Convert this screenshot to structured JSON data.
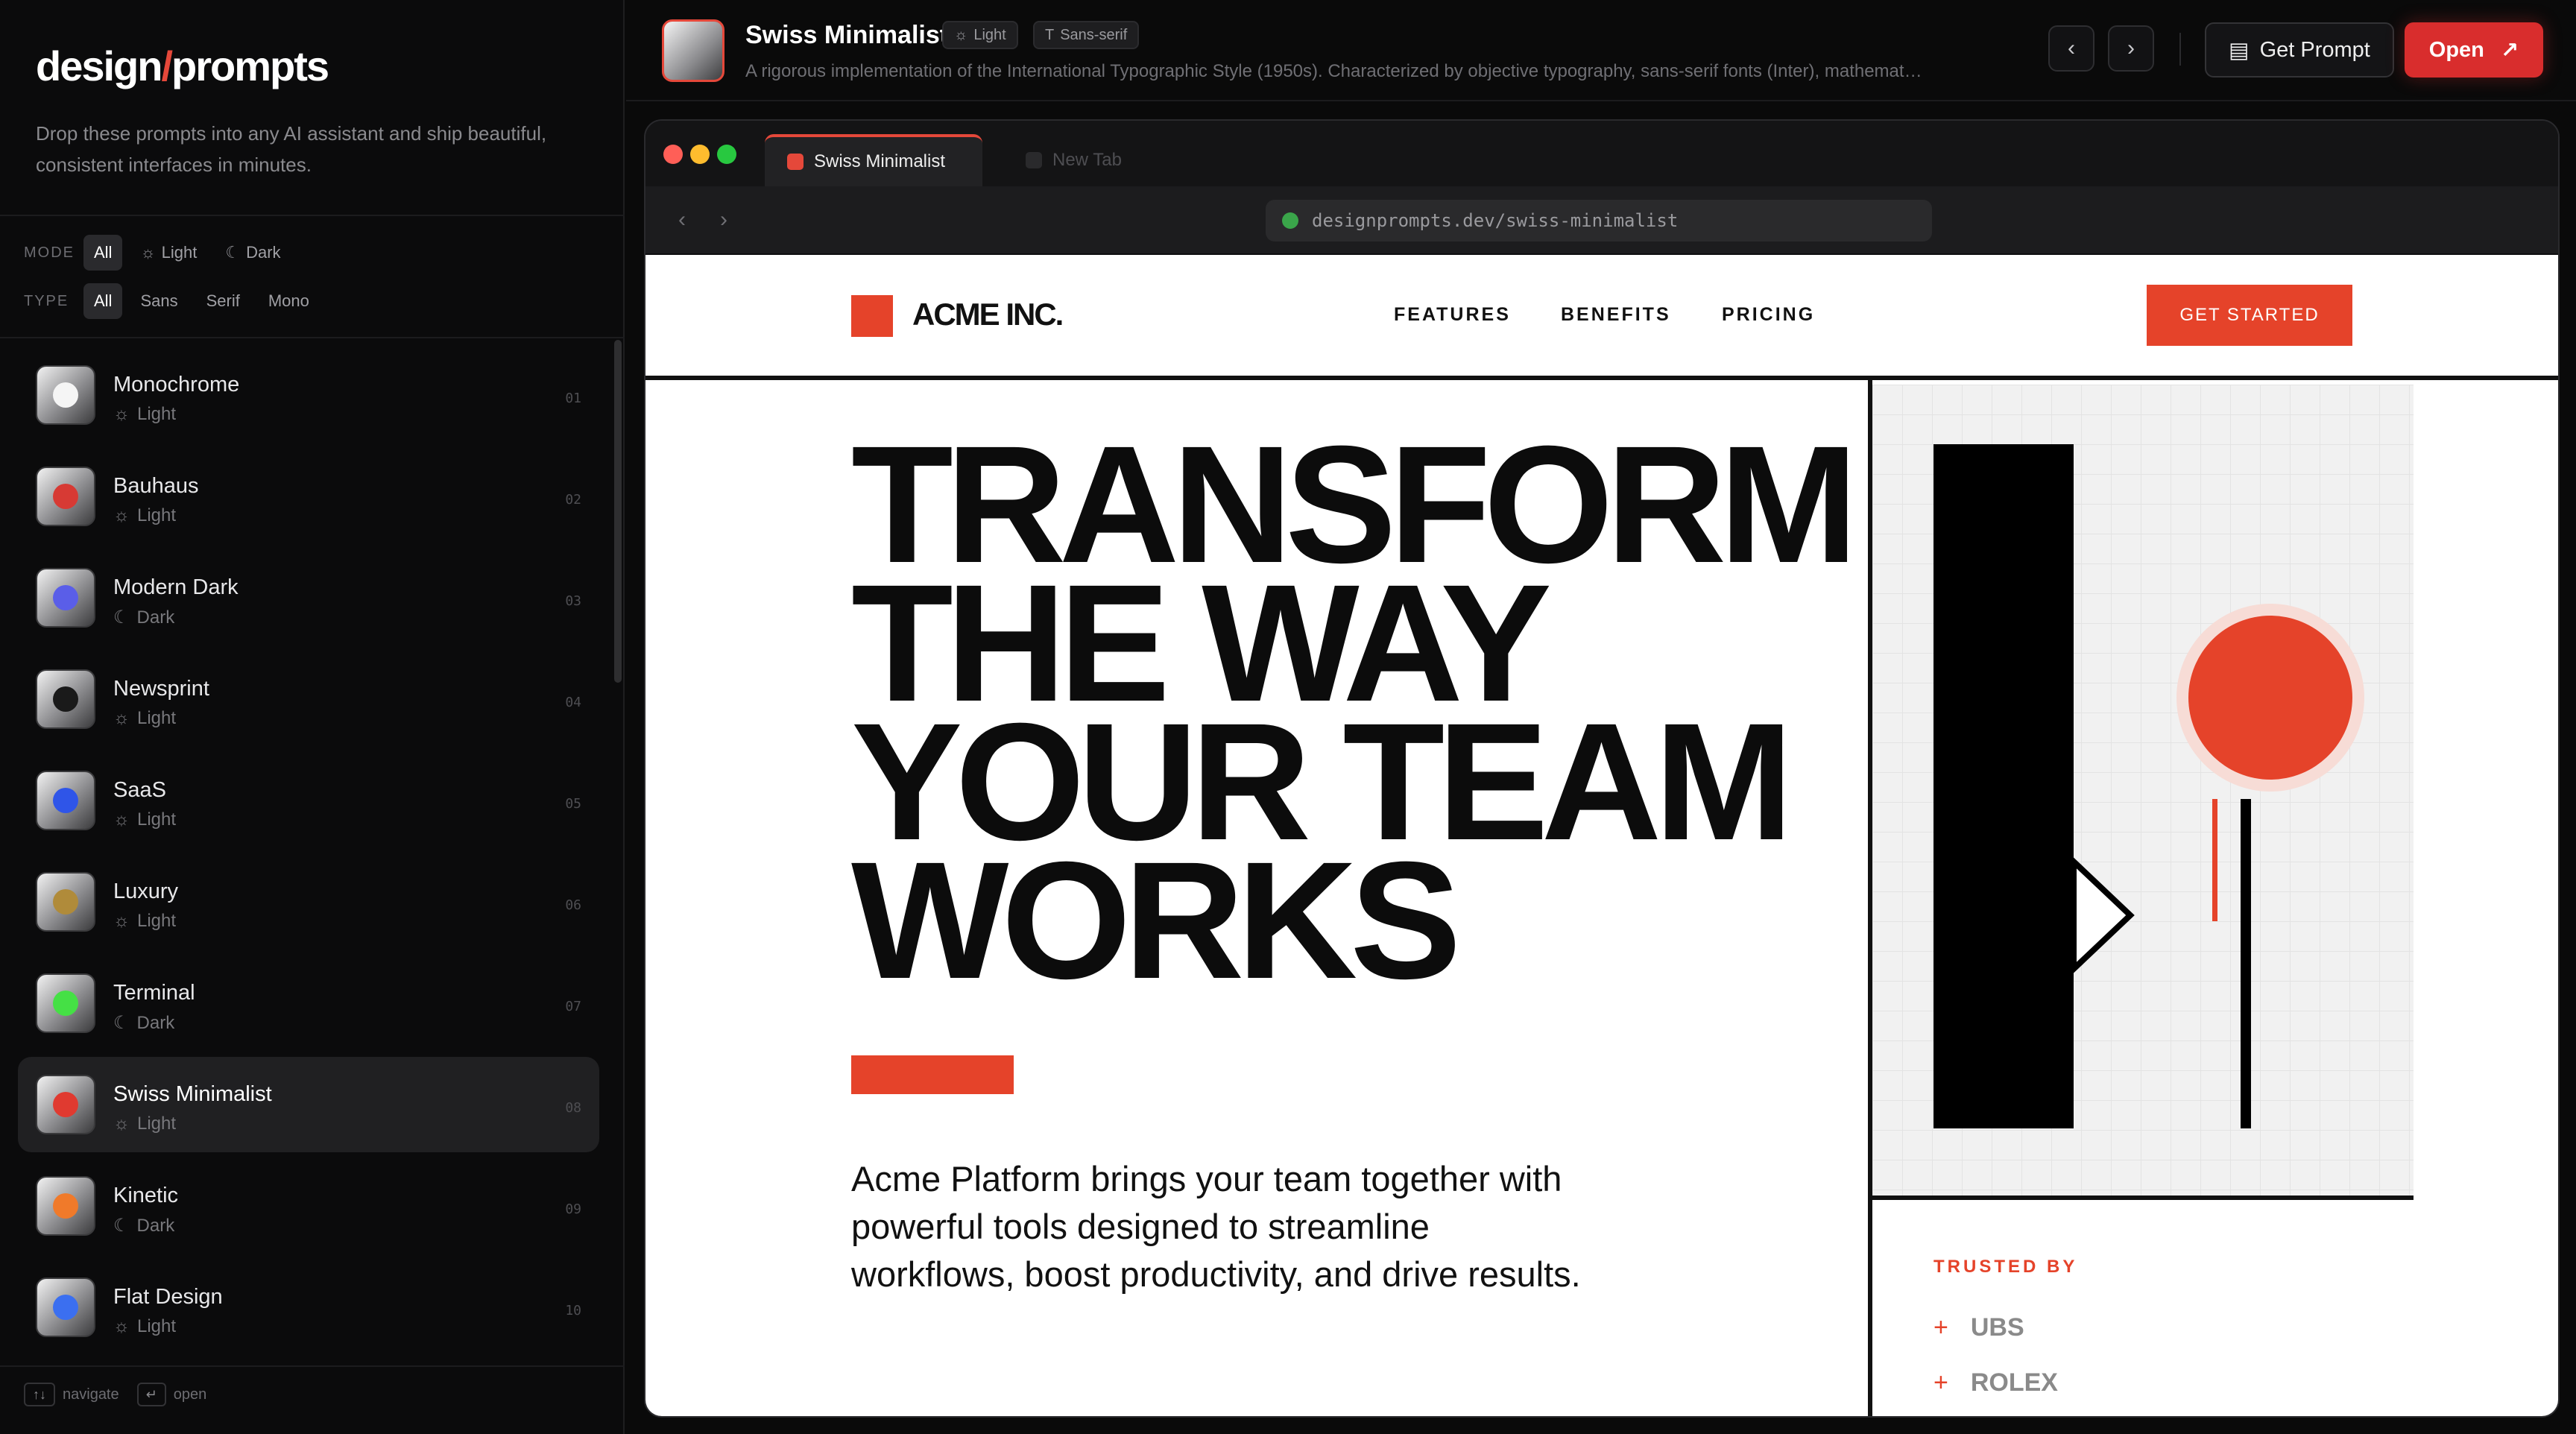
{
  "sidebar": {
    "brand_left": "design",
    "brand_slash": "/",
    "brand_right": "prompts",
    "tagline": "Drop these prompts into any AI assistant and ship beautiful, consistent interfaces in minutes.",
    "mode_label": "MODE",
    "mode_options": [
      "All",
      "Light",
      "Dark"
    ],
    "type_label": "TYPE",
    "type_options": [
      "All",
      "Sans",
      "Serif",
      "Mono"
    ],
    "items": [
      {
        "name": "Monochrome",
        "mode": "Light",
        "num": "01",
        "dot": "#f5f5f5"
      },
      {
        "name": "Bauhaus",
        "mode": "Light",
        "num": "02",
        "dot": "#d73a34"
      },
      {
        "name": "Modern Dark",
        "mode": "Dark",
        "num": "03",
        "dot": "#5a5ee8"
      },
      {
        "name": "Newsprint",
        "mode": "Light",
        "num": "04",
        "dot": "#1a1a1a"
      },
      {
        "name": "SaaS",
        "mode": "Light",
        "num": "05",
        "dot": "#2f55e8"
      },
      {
        "name": "Luxury",
        "mode": "Light",
        "num": "06",
        "dot": "#b08b3a"
      },
      {
        "name": "Terminal",
        "mode": "Dark",
        "num": "07",
        "dot": "#45e045"
      },
      {
        "name": "Swiss Minimalist",
        "mode": "Light",
        "num": "08",
        "dot": "#e03a30"
      },
      {
        "name": "Kinetic",
        "mode": "Dark",
        "num": "09",
        "dot": "#f07a2a"
      },
      {
        "name": "Flat Design",
        "mode": "Light",
        "num": "10",
        "dot": "#3b6ff0"
      }
    ],
    "hint_navigate_key": "↑↓",
    "hint_navigate": "navigate",
    "hint_open_key": "↵",
    "hint_open": "open"
  },
  "header": {
    "title": "Swiss Minimalist",
    "tag_mode": "Light",
    "tag_type": "Sans-serif",
    "description": "A rigorous implementation of the International Typographic Style (1950s). Characterized by objective typography, sans-serif fonts (Inter), mathematical grids and high contrast.",
    "get_prompt": "Get Prompt",
    "open": "Open"
  },
  "browser": {
    "tab_active": "Swiss Minimalist",
    "tab_new": "New Tab",
    "url": "designprompts.dev/swiss-minimalist"
  },
  "site": {
    "logo": "ACME INC.",
    "nav": [
      "FEATURES",
      "BENEFITS",
      "PRICING"
    ],
    "cta": "GET STARTED",
    "headline": [
      "TRANSFORM",
      "THE WAY",
      "YOUR TEAM",
      "WORKS"
    ],
    "body": "Acme Platform brings your team together with powerful tools designed to streamline workflows, boost productivity, and drive results.",
    "trusted_label": "TRUSTED BY",
    "clients": [
      "UBS",
      "ROLEX"
    ]
  },
  "colors": {
    "accent": "#e5432a",
    "open_button": "#d92d2d",
    "sidebar_bg": "#0b0b0c"
  },
  "icons": {
    "mode_light": "sun-icon",
    "mode_dark": "moon-icon",
    "type": "text-type-icon",
    "prompt": "document-icon",
    "open": "arrow-up-right-icon"
  }
}
